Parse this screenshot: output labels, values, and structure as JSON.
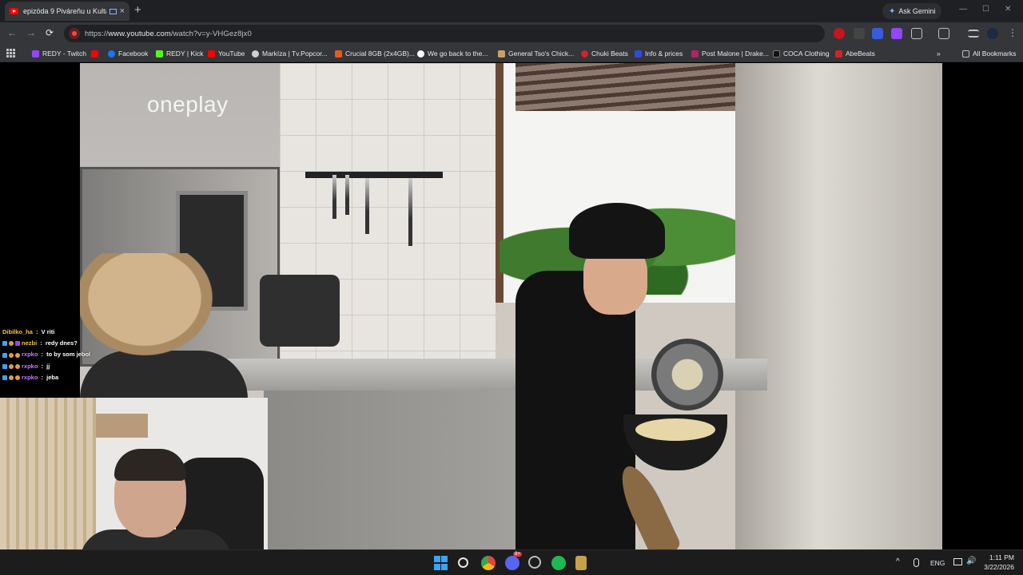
{
  "browser": {
    "tab": {
      "title": "epizóda 9 Piváreňu u Kultá",
      "close": "×"
    },
    "new_tab": "+",
    "ask_gemini": "Ask Gemini",
    "url_prefix": "https://",
    "url_host": "www.youtube.com",
    "url_path": "/watch?v=y-VHGez8jx0",
    "window_controls": [
      "—",
      "☐",
      "✕"
    ],
    "nav": {
      "back": "←",
      "forward": "→",
      "reload": "⟳"
    }
  },
  "bookmarks": [
    {
      "label": "REDY - Twitch",
      "icon": "twitch-icon",
      "color": "#9146ff"
    },
    {
      "label": "",
      "icon": "youtube-icon",
      "color": "#ff0000"
    },
    {
      "label": "Facebook",
      "icon": "facebook-icon",
      "color": "#1877f2"
    },
    {
      "label": "REDY | Kick",
      "icon": "kick-icon",
      "color": "#53fc18"
    },
    {
      "label": "YouTube",
      "icon": "youtube-icon",
      "color": "#ff0000"
    },
    {
      "label": "Markíza | Tv.Popcor...",
      "icon": "markiza-icon",
      "color": "#d0d0d0"
    },
    {
      "label": "Crucial 8GB (2x4GB)...",
      "icon": "crucial-icon",
      "color": "#e85a1a"
    },
    {
      "label": "We go back to the...",
      "icon": "google-icon",
      "color": "#ffffff"
    },
    {
      "label": "General Tso's Chick...",
      "icon": "recipe-icon",
      "color": "#c9a06a"
    },
    {
      "label": "Chuki Beats",
      "icon": "chuki-icon",
      "color": "#d2232a"
    },
    {
      "label": "Info & prices",
      "icon": "b-icon",
      "color": "#2d4dd8"
    },
    {
      "label": "Post Malone | Drake...",
      "icon": "music-icon",
      "color": "#b0245f"
    },
    {
      "label": "COCA Clothing",
      "icon": "coca-icon",
      "color": "#111111"
    },
    {
      "label": "AbeBeats",
      "icon": "abebeats-icon",
      "color": "#d2232a"
    }
  ],
  "bookmarks_overflow": "»",
  "all_bookmarks": "All Bookmarks",
  "video": {
    "brand_watermark": "oneplay"
  },
  "chat": [
    {
      "user": "Dibilko_ha",
      "message": "V riti",
      "user_color": "#f5c542",
      "badges": 0
    },
    {
      "user": "nezbi",
      "message": "redy dnes?",
      "user_color": "#f5c542",
      "badges": 3
    },
    {
      "user": "rxpko",
      "message": "to by som jebol",
      "user_color": "#c879ff",
      "badges": 3
    },
    {
      "user": "rxpko",
      "message": "jj",
      "user_color": "#c879ff",
      "badges": 3
    },
    {
      "user": "rxpko",
      "message": "jeba",
      "user_color": "#c879ff",
      "badges": 3
    }
  ],
  "taskbar": {
    "language": "ENG",
    "time": "1:11 PM",
    "date": "3/22/2026",
    "discord_badge": "9+",
    "tray_chevron": "^"
  }
}
